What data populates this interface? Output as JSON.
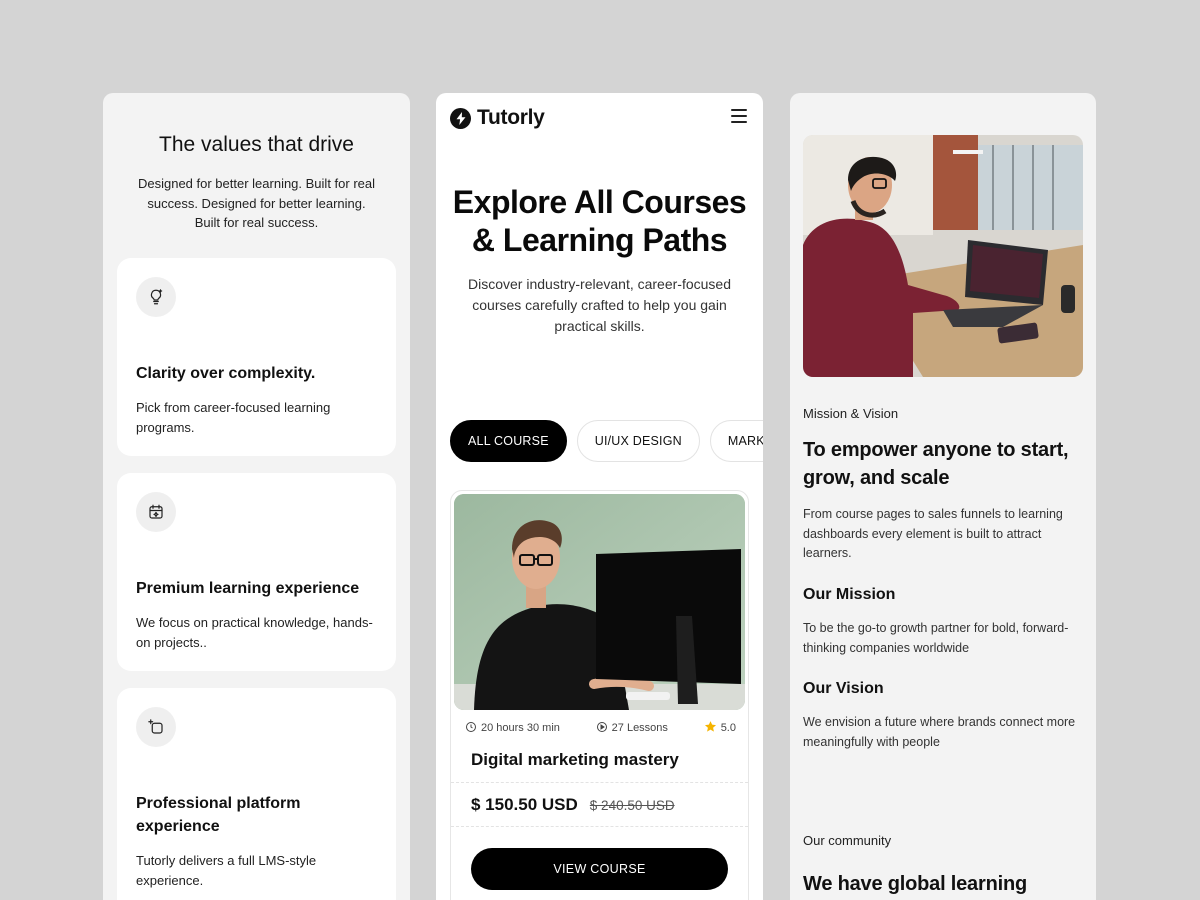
{
  "left": {
    "title": "The values that drive",
    "subtitle": "Designed for better learning. Built for real success. Designed for better learning. Built for real success.",
    "cards": [
      {
        "icon": "lightbulb-icon",
        "title": "Clarity over complexity.",
        "desc": "Pick from career-focused learning programs."
      },
      {
        "icon": "calendar-sparkle-icon",
        "title": "Premium learning experience",
        "desc": "We focus on practical knowledge, hands-on projects.."
      },
      {
        "icon": "square-plus-icon",
        "title": "Professional platform experience",
        "desc": "Tutorly delivers a full LMS-style experience."
      }
    ]
  },
  "mid": {
    "brand": "Tutorly",
    "hero_title": "Explore All Courses & Learning Paths",
    "hero_sub": "Discover industry-relevant, career-focused courses carefully crafted to help you gain practical skills.",
    "chips": [
      "ALL COURSE",
      "UI/UX DESIGN",
      "MARKETING"
    ],
    "course": {
      "duration": "20 hours 30 min",
      "lessons": "27 Lessons",
      "rating": "5.0",
      "title": "Digital marketing mastery",
      "price": "$ 150.50 USD",
      "old_price": "$ 240.50 USD",
      "cta": "VIEW COURSE"
    }
  },
  "right": {
    "label1": "Mission & Vision",
    "heading1": "To empower anyone to start, grow, and scale",
    "para1": "From course pages to sales funnels to learning dashboards every element is built to attract learners.",
    "mission_title": "Our Mission",
    "mission_text": "To be the go-to growth partner for bold, forward-thinking companies worldwide",
    "vision_title": "Our Vision",
    "vision_text": "We envision a future where brands connect more meaningfully with people",
    "label2": "Our community",
    "heading2": "We have global learning"
  },
  "colors": {
    "background": "#d4d4d4",
    "panel": "#f3f3f3",
    "accent": "#000000",
    "star": "#f5b400"
  }
}
